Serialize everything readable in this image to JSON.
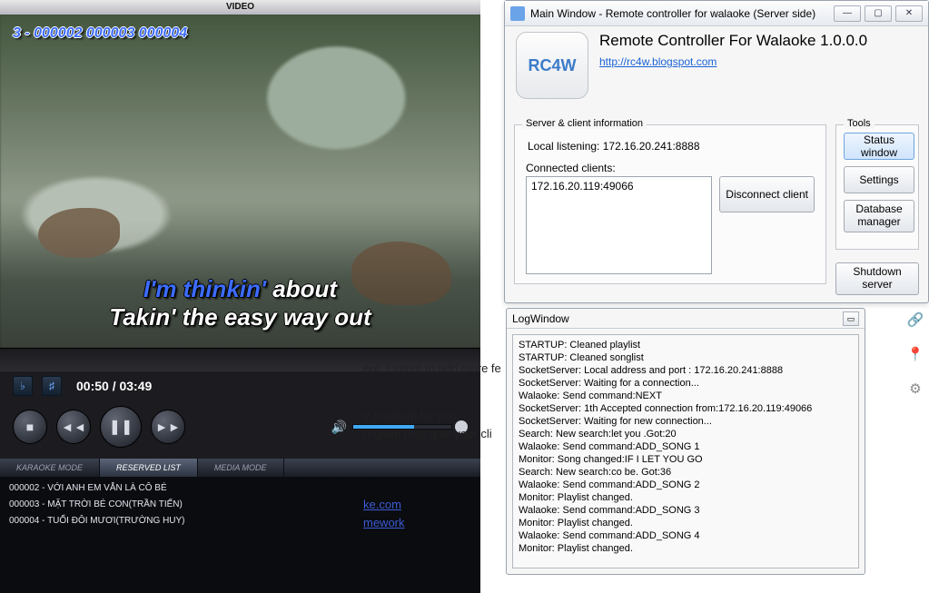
{
  "video": {
    "title": "VIDEO",
    "osd": "3 - 000002 000003 000004",
    "lyric_hi": "I'm thinkin'",
    "lyric_rest": " about",
    "lyric_line2": "Takin' the easy way out",
    "time": "00:50 / 03:49",
    "tabs": {
      "karaoke": "KARAOKE MODE",
      "reserved": "RESERVED LIST",
      "media": "MEDIA MODE"
    },
    "playlist": [
      "000002 - VỚI ANH EM VẪN LÀ CÔ BÉ",
      "000003 - MẶT TRỜI BÉ CON(TRẦN TIẾN)",
      "000004 - TUỔI ĐÔI MƯƠI(TRƯỜNG HUY)"
    ]
  },
  "page": {
    "frag1": "ent. I intent to add more fe",
    "frag2": "e program for you.",
    "frag3": "rogram may give your cli",
    "link1": "ke.com",
    "link2": "mework"
  },
  "main": {
    "titlebar": "Main Window - Remote controller for walaoke (Server side)",
    "app_logo": "RC4W",
    "app_title": "Remote Controller For Walaoke 1.0.0.0",
    "app_link": "http://rc4w.blogspot.com",
    "server_group": "Server & client information",
    "listening": "Local listening: 172.16.20.241:8888",
    "clients_label": "Connected clients:",
    "clients": [
      "172.16.20.119:49066"
    ],
    "disconnect": "Disconnect client",
    "tools_group": "Tools",
    "tools": {
      "status": "Status window",
      "settings": "Settings",
      "db": "Database manager",
      "shutdown": "Shutdown server"
    }
  },
  "log": {
    "title": "LogWindow",
    "lines": [
      "STARTUP: Cleaned playlist",
      "STARTUP: Cleaned songlist",
      "SocketServer: Local address and port : 172.16.20.241:8888",
      "SocketServer: Waiting for a connection...",
      "Walaoke: Send command:NEXT",
      "SocketServer: 1th Accepted connection from:172.16.20.119:49066",
      "SocketServer: Waiting for new connection...",
      "Search: New search:let you .Got:20",
      "Walaoke: Send command:ADD_SONG 1",
      "Monitor: Song changed:IF I LET YOU GO",
      "Search: New search:co be. Got:36",
      "Walaoke: Send command:ADD_SONG 2",
      "Monitor: Playlist changed.",
      "Walaoke: Send command:ADD_SONG 3",
      "Monitor: Playlist changed.",
      "Walaoke: Send command:ADD_SONG 4",
      "Monitor: Playlist changed."
    ]
  },
  "winbtns": {
    "min": "—",
    "max": "▢",
    "close": "✕"
  }
}
